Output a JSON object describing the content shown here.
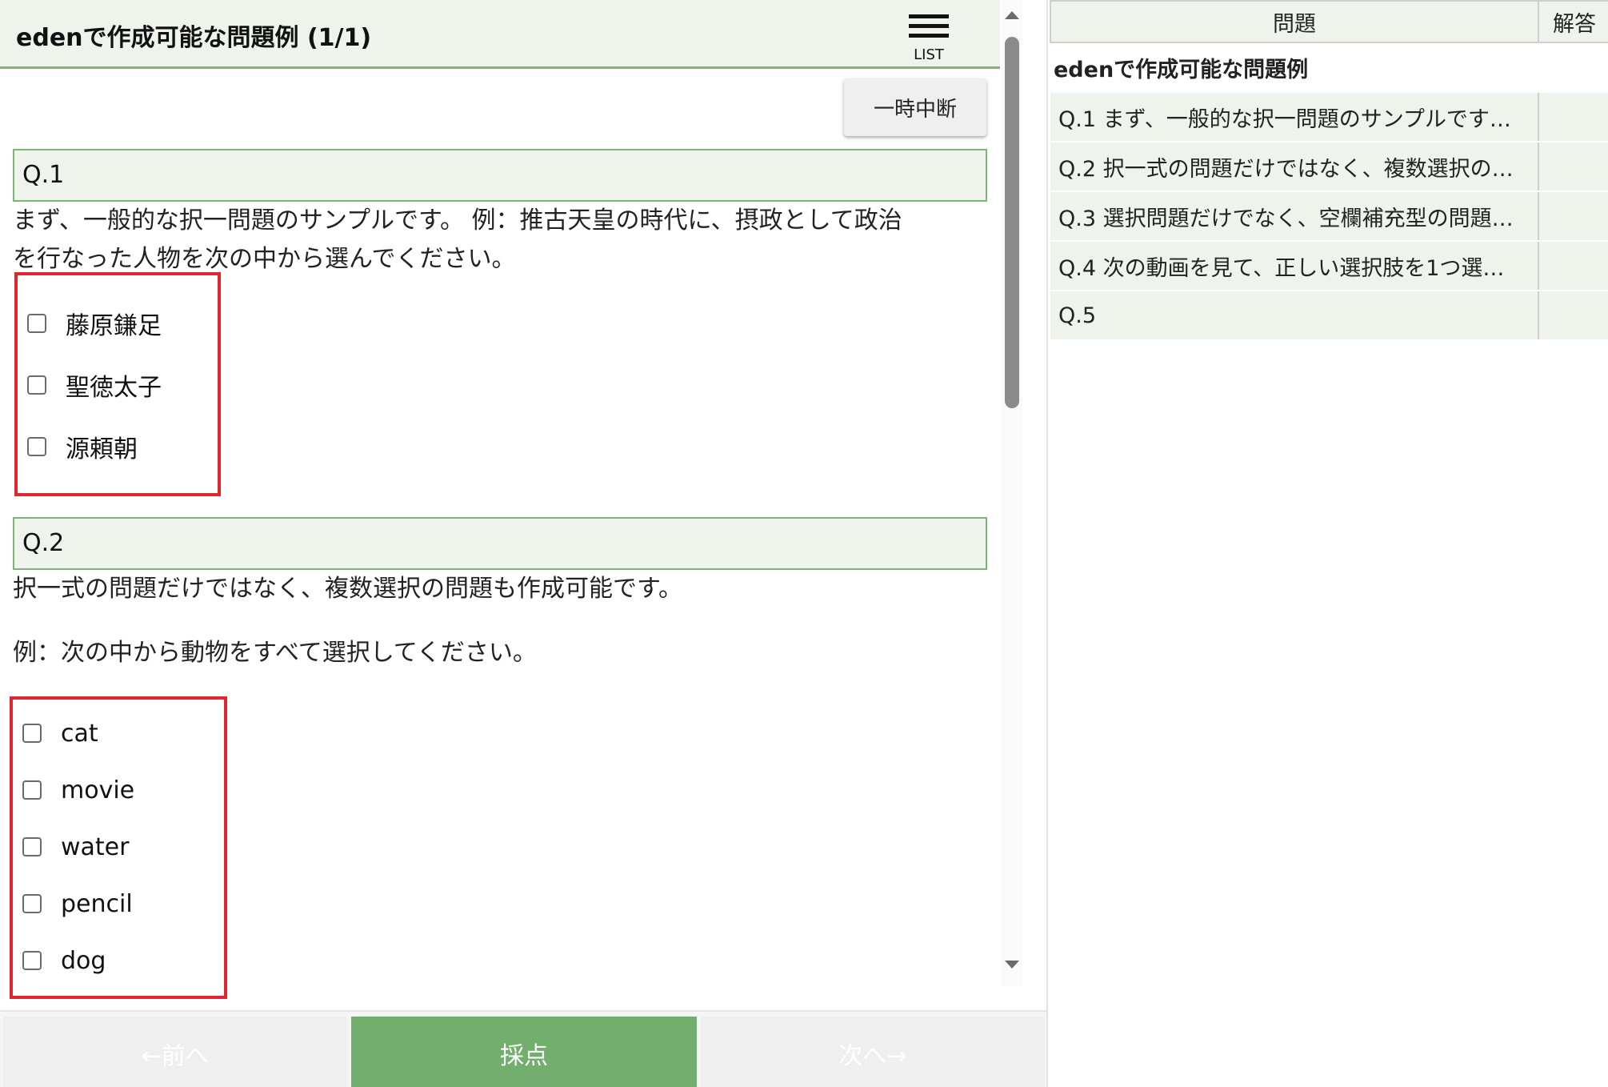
{
  "header": {
    "title": "edenで作成可能な問題例 (1/1)",
    "list_label": "LIST",
    "pause_label": "一時中断"
  },
  "questions": [
    {
      "number": "Q.1",
      "text_lines": [
        "まず、一般的な択一問題のサンプルです。 例：推古天皇の時代に、摂政として政治",
        "を行なった人物を次の中から選んでください。"
      ],
      "choices": [
        "藤原鎌足",
        "聖徳太子",
        "源頼朝"
      ]
    },
    {
      "number": "Q.2",
      "text_lines": [
        "択一式の問題だけではなく、複数選択の問題も作成可能です。",
        "例：次の中から動物をすべて選択してください。"
      ],
      "choices": [
        "cat",
        "movie",
        "water",
        "pencil",
        "dog"
      ]
    }
  ],
  "footer": {
    "prev_label": "←前へ",
    "grade_label": "採点",
    "next_label": "次へ→"
  },
  "sidebar": {
    "col_question": "問題",
    "col_answer": "解答",
    "section_title": "edenで作成可能な問題例",
    "items": [
      {
        "label": "Q.1 まず、一般的な択一問題のサンプルです…",
        "answer": ""
      },
      {
        "label": "Q.2 択一式の問題だけではなく、複数選択の…",
        "answer": ""
      },
      {
        "label": "Q.3 選択問題だけでなく、空欄補充型の問題…",
        "answer": ""
      },
      {
        "label": "Q.4 次の動画を見て、正しい選択肢を1つ選…",
        "answer": ""
      },
      {
        "label": "Q.5",
        "answer": ""
      }
    ]
  },
  "colors": {
    "accent_green": "#72af6e",
    "header_bg": "#eef3ec",
    "highlight_red": "#e0262f"
  }
}
